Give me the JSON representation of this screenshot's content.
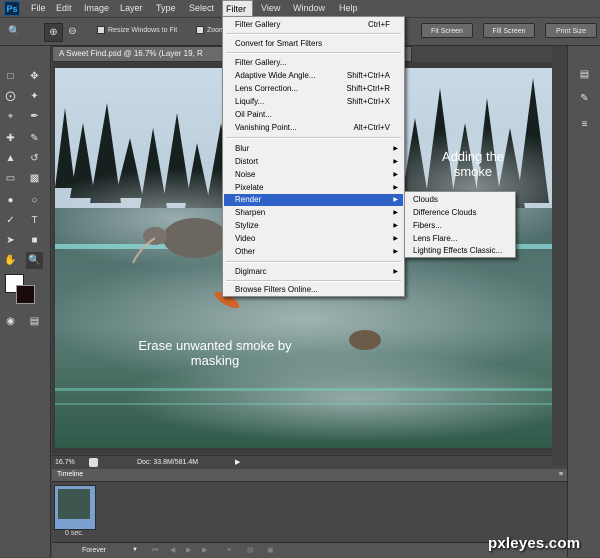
{
  "app": {
    "logo": "Ps"
  },
  "menubar": {
    "items": [
      "File",
      "Edit",
      "Image",
      "Layer",
      "Type",
      "Select",
      "Filter",
      "View",
      "Window",
      "Help"
    ],
    "active": "Filter"
  },
  "options_bar": {
    "resize_windows_label": "Resize Windows to Fit",
    "zoom_label": "Zoom",
    "fit_screen": "Fit Screen",
    "fill_screen": "Fill Screen",
    "print_size": "Print Size"
  },
  "document": {
    "tab_title": "A Sweet Find.psd @ 16.7% (Layer 19, R",
    "annotation_smoke": [
      "Adding the",
      "smoke"
    ],
    "annotation_mask": [
      "Erase unwanted smoke by",
      "masking"
    ]
  },
  "status": {
    "zoom": "16.7%",
    "doc_size": "Doc: 33.8M/581.4M"
  },
  "timeline": {
    "title": "Timeline",
    "frame_delay": "0 sec.",
    "loop": "Forever"
  },
  "filter_menu": {
    "filter_gallery_last": {
      "label": "Filter Gallery",
      "shortcut": "Ctrl+F"
    },
    "convert_smart": "Convert for Smart Filters",
    "filter_gallery": "Filter Gallery...",
    "adaptive_wide": {
      "label": "Adaptive Wide Angle...",
      "shortcut": "Shift+Ctrl+A"
    },
    "lens_correction": {
      "label": "Lens Correction...",
      "shortcut": "Shift+Ctrl+R"
    },
    "liquify": {
      "label": "Liquify...",
      "shortcut": "Shift+Ctrl+X"
    },
    "oil_paint": "Oil Paint...",
    "vanishing_point": {
      "label": "Vanishing Point...",
      "shortcut": "Alt+Ctrl+V"
    },
    "blur": "Blur",
    "distort": "Distort",
    "noise": "Noise",
    "pixelate": "Pixelate",
    "render": "Render",
    "sharpen": "Sharpen",
    "stylize": "Stylize",
    "video": "Video",
    "other": "Other",
    "digimarc": "Digimarc",
    "browse_online": "Browse Filters Online..."
  },
  "render_submenu": [
    "Clouds",
    "Difference Clouds",
    "Fibers...",
    "Lens Flare...",
    "Lighting Effects Classic..."
  ],
  "watermark": "pxleyes.com",
  "colors": {
    "highlight": "#2f62c9",
    "ui_dark": "#535353",
    "menu_bg": "#f0f0f0"
  }
}
